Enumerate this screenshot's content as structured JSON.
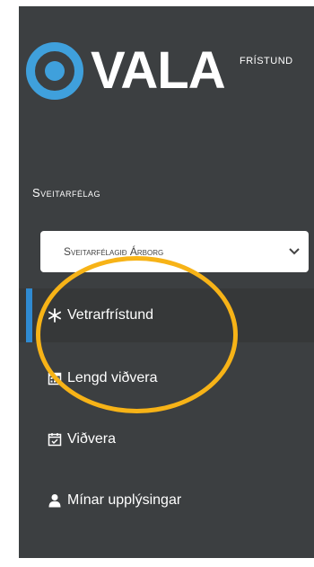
{
  "brand": {
    "name": "VALA",
    "subtitle": "FRÍSTUND"
  },
  "municipality": {
    "section_label": "Sveitarfélag",
    "selected": "Sveitarfélagið Árborg"
  },
  "menu": {
    "items": [
      {
        "label": "Vetrarfrístund",
        "icon": "snowflake-icon",
        "active": true
      },
      {
        "label": "Lengd viðvera",
        "icon": "calendar-grid-icon",
        "active": false
      },
      {
        "label": "Viðvera",
        "icon": "calendar-check-icon",
        "active": false
      },
      {
        "label": "Mínar upplýsingar",
        "icon": "user-icon",
        "active": false
      }
    ]
  },
  "colors": {
    "sidebar_bg": "#3c3f41",
    "accent": "#2f8ad1",
    "highlight": "#f7b317",
    "logo_blue": "#3fa0dc"
  }
}
